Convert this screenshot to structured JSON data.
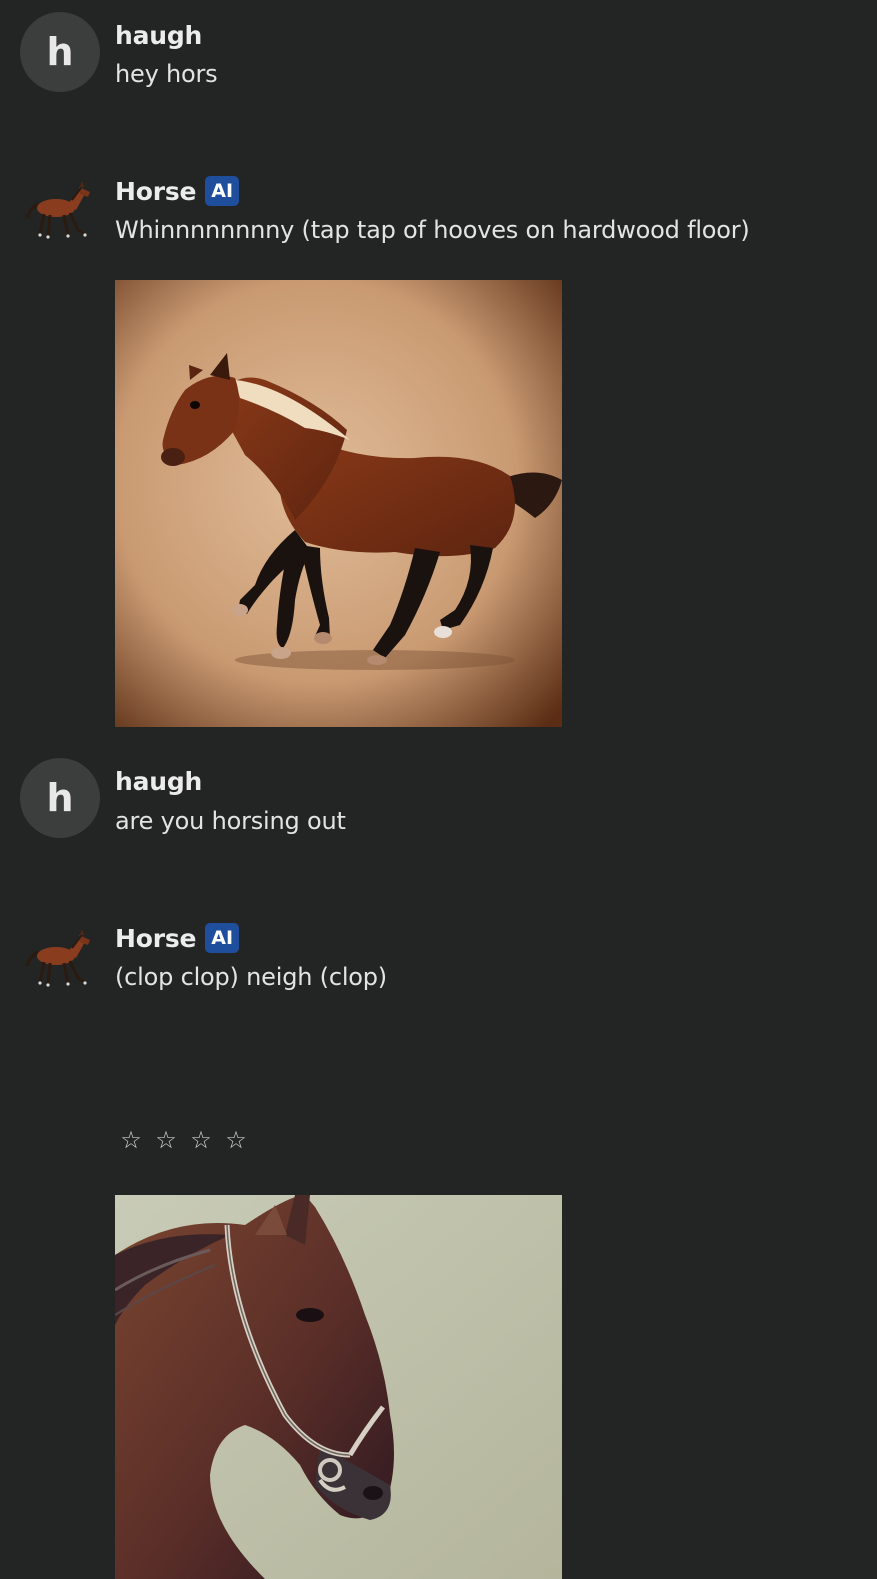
{
  "messages": [
    {
      "author": "haugh",
      "avatar_letter": "h",
      "text": "hey hors"
    },
    {
      "author": "Horse",
      "badge": "AI",
      "avatar_icon": "horse-avatar-icon",
      "text": "Whinnnnnnnny (tap tap of hooves on hardwood floor)",
      "image": "brown-horse-trotting-image"
    },
    {
      "author": "haugh",
      "avatar_letter": "h",
      "text": "are you horsing out"
    },
    {
      "author": "Horse",
      "badge": "AI",
      "avatar_icon": "horse-avatar-icon",
      "text": "(clop clop) neigh (clop)",
      "image": "horse-head-bridle-image"
    }
  ],
  "rating": {
    "stars": [
      "☆",
      "☆",
      "☆",
      "☆"
    ],
    "value": 0,
    "max": 4
  },
  "colors": {
    "background": "#232424",
    "avatar_bg": "#3c3d3d",
    "badge_bg": "#1f4f9c",
    "text": "#e3e3e3"
  }
}
